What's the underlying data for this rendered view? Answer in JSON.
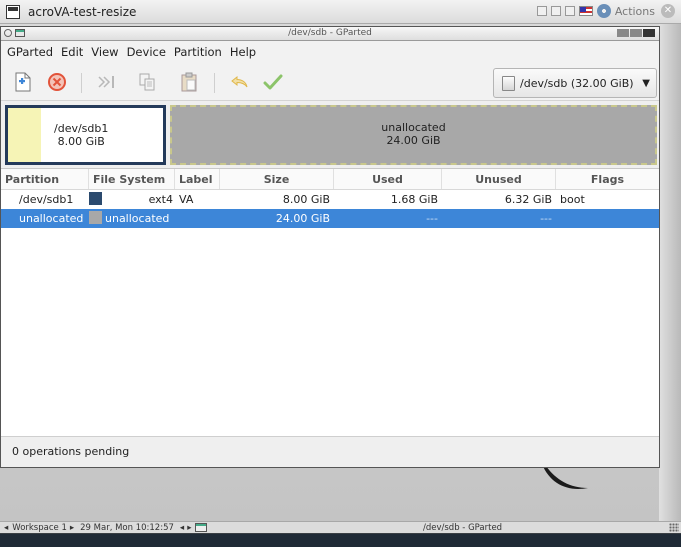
{
  "outer_window": {
    "title": "acroVA-test-resize",
    "actions_label": "Actions"
  },
  "gparted_window": {
    "title": "/dev/sdb - GParted"
  },
  "menu": [
    "GParted",
    "Edit",
    "View",
    "Device",
    "Partition",
    "Help"
  ],
  "toolbar": {
    "device_selector": "/dev/sdb (32.00 GiB)",
    "icons": [
      "new-partition-icon",
      "delete-icon",
      "resize-move-icon",
      "copy-icon",
      "paste-icon",
      "undo-icon",
      "apply-icon"
    ]
  },
  "partition_map": {
    "sdb1": {
      "name": "/dev/sdb1",
      "size": "8.00 GiB"
    },
    "unallocated": {
      "name": "unallocated",
      "size": "24.00 GiB"
    }
  },
  "table": {
    "columns": [
      "Partition",
      "File System",
      "Label",
      "Size",
      "Used",
      "Unused",
      "Flags"
    ],
    "rows": [
      {
        "partition": "/dev/sdb1",
        "fs": "ext4",
        "label": "VA",
        "size": "8.00 GiB",
        "used": "1.68 GiB",
        "unused": "6.32 GiB",
        "flags": "boot",
        "color": "#2b4a6e"
      },
      {
        "partition": "unallocated",
        "fs": "unallocated",
        "label": "",
        "size": "24.00 GiB",
        "used": "---",
        "unused": "---",
        "flags": "",
        "color": "#a8a8a8"
      }
    ]
  },
  "status": "0 operations pending",
  "taskbar": {
    "workspace": "Workspace 1",
    "clock": "29 Mar, Mon 10:12:57",
    "task_title": "/dev/sdb - GParted"
  },
  "colors": {
    "selection": "#3d86d8",
    "ext4": "#2b4a6e",
    "unallocated": "#a8a8a8",
    "map_used": "#f6f4b6"
  }
}
